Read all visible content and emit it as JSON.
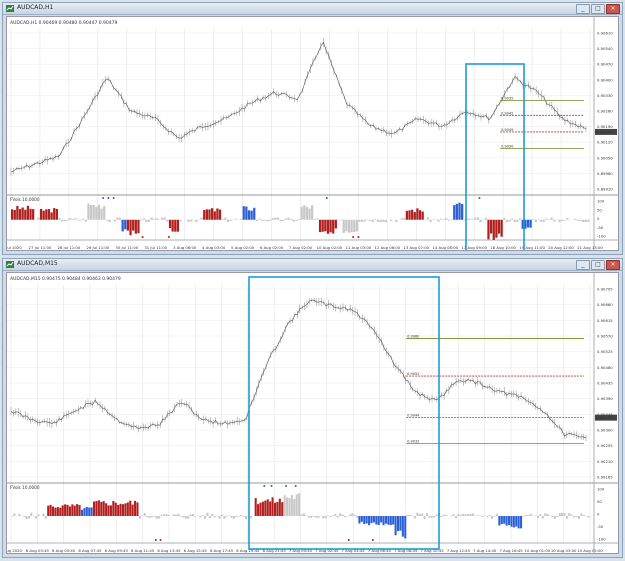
{
  "top": {
    "window_title": "AUDCAD,H1",
    "info_line": "AUDCAD,H1  0.90469 0.90480 0.90447 0.90479",
    "indicator_label": "FVols 10,0000",
    "price_ticks": [
      "0.90610",
      "0.90540",
      "0.90470",
      "0.90400",
      "0.90330",
      "0.90260",
      "0.90190",
      "0.90120",
      "0.90050",
      "0.89980",
      "0.89910"
    ],
    "price_marker": "0.90479",
    "osc_ticks": [
      "100",
      "50",
      "0",
      "-50",
      "-100"
    ],
    "time_ticks": [
      "27 Jul 2020",
      "27 Jul 11:00",
      "28 Jul 11:00",
      "29 Jul 11:00",
      "30 Jul 11:00",
      "31 Jul 11:00",
      "3 Aug 06:00",
      "4 Aug 03:00",
      "5 Aug 02:00",
      "6 Aug 02:00",
      "7 Aug 02:00",
      "10 Aug 02:00",
      "11 Aug 03:00",
      "12 Aug 06:00",
      "13 Aug 07:00",
      "14 Aug 08:00",
      "17 Aug 09:00",
      "18 Aug 10:00",
      "19 Aug 11:00",
      "20 Aug 12:00",
      "21 Aug 13:00"
    ],
    "level_labels": [
      "0.9035",
      "0.9042",
      "0.9049",
      "0.9030"
    ]
  },
  "bottom": {
    "window_title": "AUDCAD,M15",
    "info_line": "AUDCAD,M15  0.90475 0.90484 0.90463 0.90479",
    "indicator_label": "FVols 10,0000",
    "price_ticks": [
      "0.90705",
      "0.90660",
      "0.90615",
      "0.90570",
      "0.90525",
      "0.90480",
      "0.90435",
      "0.90390",
      "0.90345",
      "0.90300",
      "0.90255",
      "0.90210",
      "0.90165"
    ],
    "price_marker": "0.90479",
    "osc_ticks": [
      "100",
      "50",
      "0",
      "-50",
      "-100"
    ],
    "time_ticks": [
      "6 Aug 2020",
      "6 Aug 03:45",
      "6 Aug 05:45",
      "6 Aug 07:45",
      "6 Aug 09:45",
      "6 Aug 11:45",
      "6 Aug 13:45",
      "6 Aug 15:45",
      "6 Aug 17:45",
      "6 Aug 19:45",
      "6 Aug 21:45",
      "7 Aug 00:45",
      "7 Aug 02:45",
      "7 Aug 04:45",
      "7 Aug 06:45",
      "7 Aug 08:45",
      "7 Aug 10:45",
      "7 Aug 12:45",
      "7 Aug 14:45",
      "7 Aug 16:45",
      "10 Aug 01:00",
      "10 Aug 03:00",
      "10 Aug 05:00"
    ],
    "level_labels": [
      "0.9060",
      "0.9052",
      "0.9044",
      "0.9032"
    ]
  },
  "colors": {
    "highlight": "#1e9bd7",
    "bull": "#b01e1e",
    "bear": "#2a5fd6",
    "neutral": "#c8c8c8",
    "level_green": "#6b8e23",
    "level_red": "#c0392b"
  }
}
